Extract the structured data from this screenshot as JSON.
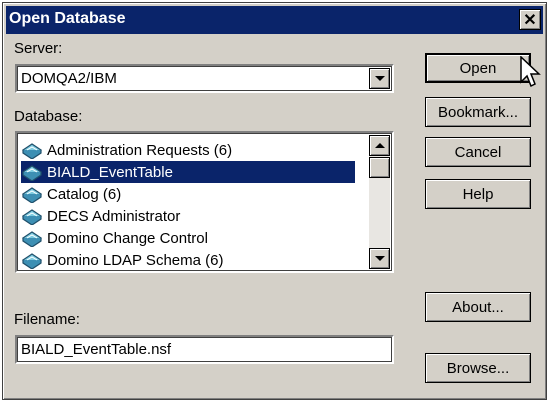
{
  "dialog": {
    "title": "Open Database",
    "close_glyph": "✕"
  },
  "server": {
    "label": "Server:",
    "value": "DOMQA2/IBM"
  },
  "database": {
    "label": "Database:",
    "items": [
      {
        "label": "Administration Requests (6)",
        "icon": "database-book-icon"
      },
      {
        "label": "BIALD_EventTable",
        "icon": "database-book-icon",
        "selected": true
      },
      {
        "label": "Catalog (6)",
        "icon": "database-book-icon"
      },
      {
        "label": "DECS Administrator",
        "icon": "database-book-icon"
      },
      {
        "label": "Domino Change Control",
        "icon": "database-book-icon"
      },
      {
        "label": "Domino LDAP Schema (6)",
        "icon": "database-book-icon"
      }
    ]
  },
  "filename": {
    "label": "Filename:",
    "value": "BIALD_EventTable.nsf"
  },
  "buttons": {
    "open": "Open",
    "bookmark": "Bookmark...",
    "cancel": "Cancel",
    "help": "Help",
    "about": "About...",
    "browse": "Browse..."
  },
  "colors": {
    "title_bar": "#0a246a",
    "dialog_bg": "#d4d0c8",
    "selection": "#0a246a"
  }
}
